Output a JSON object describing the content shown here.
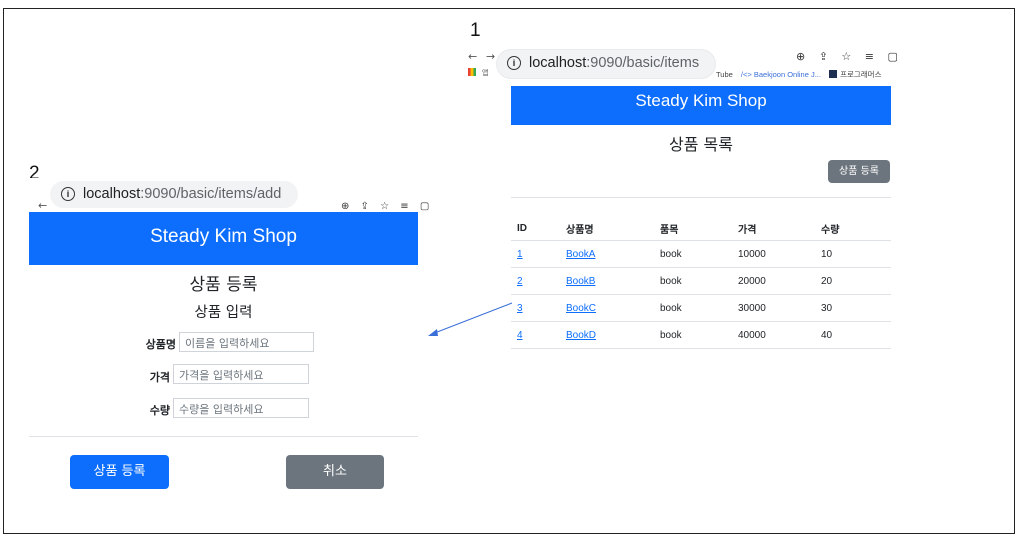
{
  "markers": {
    "one": "1",
    "two": "2"
  },
  "list_page": {
    "url_host": "localhost",
    "url_path": ":9090/basic/items",
    "nav_back": "←",
    "nav_forward": "→",
    "toolbar_icons": "⊕ ⇪ ☆ ≡ ▢",
    "apps_label": "앱",
    "bookmarks": {
      "youtube": "Tube",
      "baekjoon": "/<> Baekjoon Online J...",
      "programmers": "프로그래머스"
    },
    "shop_name": "Steady Kim Shop",
    "page_title": "상품 목록",
    "register_button": "상품 등록",
    "table": {
      "headers": [
        "ID",
        "상품명",
        "품목",
        "가격",
        "수량"
      ],
      "rows": [
        [
          "1",
          "BookA",
          "book",
          "10000",
          "10"
        ],
        [
          "2",
          "BookB",
          "book",
          "20000",
          "20"
        ],
        [
          "3",
          "BookC",
          "book",
          "30000",
          "30"
        ],
        [
          "4",
          "BookD",
          "book",
          "40000",
          "40"
        ]
      ]
    }
  },
  "add_page": {
    "url_host": "localhost",
    "url_path": ":9090/basic/items/add",
    "nav_back": "←",
    "toolbar_icons": "⊕ ⇪ ☆ ≡ ▢",
    "shop_name": "Steady Kim Shop",
    "page_title": "상품 등록",
    "section_title": "상품 입력",
    "fields": [
      {
        "label": "상품명",
        "placeholder": "이름을 입력하세요"
      },
      {
        "label": "가격",
        "placeholder": "가격을 입력하세요"
      },
      {
        "label": "수량",
        "placeholder": "수량을 입력하세요"
      }
    ],
    "submit_button": "상품 등록",
    "cancel_button": "취소"
  },
  "colors": {
    "primary": "#0d6efd",
    "secondary": "#6c757d",
    "arrow": "#3a6fd8"
  }
}
